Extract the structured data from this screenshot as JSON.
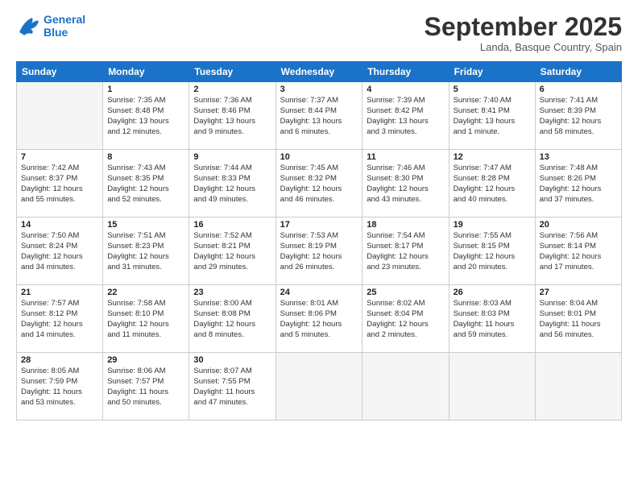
{
  "logo": {
    "line1": "General",
    "line2": "Blue"
  },
  "title": "September 2025",
  "subtitle": "Landa, Basque Country, Spain",
  "days_of_week": [
    "Sunday",
    "Monday",
    "Tuesday",
    "Wednesday",
    "Thursday",
    "Friday",
    "Saturday"
  ],
  "weeks": [
    [
      {
        "day": "",
        "info": ""
      },
      {
        "day": "1",
        "info": "Sunrise: 7:35 AM\nSunset: 8:48 PM\nDaylight: 13 hours\nand 12 minutes."
      },
      {
        "day": "2",
        "info": "Sunrise: 7:36 AM\nSunset: 8:46 PM\nDaylight: 13 hours\nand 9 minutes."
      },
      {
        "day": "3",
        "info": "Sunrise: 7:37 AM\nSunset: 8:44 PM\nDaylight: 13 hours\nand 6 minutes."
      },
      {
        "day": "4",
        "info": "Sunrise: 7:39 AM\nSunset: 8:42 PM\nDaylight: 13 hours\nand 3 minutes."
      },
      {
        "day": "5",
        "info": "Sunrise: 7:40 AM\nSunset: 8:41 PM\nDaylight: 13 hours\nand 1 minute."
      },
      {
        "day": "6",
        "info": "Sunrise: 7:41 AM\nSunset: 8:39 PM\nDaylight: 12 hours\nand 58 minutes."
      }
    ],
    [
      {
        "day": "7",
        "info": "Sunrise: 7:42 AM\nSunset: 8:37 PM\nDaylight: 12 hours\nand 55 minutes."
      },
      {
        "day": "8",
        "info": "Sunrise: 7:43 AM\nSunset: 8:35 PM\nDaylight: 12 hours\nand 52 minutes."
      },
      {
        "day": "9",
        "info": "Sunrise: 7:44 AM\nSunset: 8:33 PM\nDaylight: 12 hours\nand 49 minutes."
      },
      {
        "day": "10",
        "info": "Sunrise: 7:45 AM\nSunset: 8:32 PM\nDaylight: 12 hours\nand 46 minutes."
      },
      {
        "day": "11",
        "info": "Sunrise: 7:46 AM\nSunset: 8:30 PM\nDaylight: 12 hours\nand 43 minutes."
      },
      {
        "day": "12",
        "info": "Sunrise: 7:47 AM\nSunset: 8:28 PM\nDaylight: 12 hours\nand 40 minutes."
      },
      {
        "day": "13",
        "info": "Sunrise: 7:48 AM\nSunset: 8:26 PM\nDaylight: 12 hours\nand 37 minutes."
      }
    ],
    [
      {
        "day": "14",
        "info": "Sunrise: 7:50 AM\nSunset: 8:24 PM\nDaylight: 12 hours\nand 34 minutes."
      },
      {
        "day": "15",
        "info": "Sunrise: 7:51 AM\nSunset: 8:23 PM\nDaylight: 12 hours\nand 31 minutes."
      },
      {
        "day": "16",
        "info": "Sunrise: 7:52 AM\nSunset: 8:21 PM\nDaylight: 12 hours\nand 29 minutes."
      },
      {
        "day": "17",
        "info": "Sunrise: 7:53 AM\nSunset: 8:19 PM\nDaylight: 12 hours\nand 26 minutes."
      },
      {
        "day": "18",
        "info": "Sunrise: 7:54 AM\nSunset: 8:17 PM\nDaylight: 12 hours\nand 23 minutes."
      },
      {
        "day": "19",
        "info": "Sunrise: 7:55 AM\nSunset: 8:15 PM\nDaylight: 12 hours\nand 20 minutes."
      },
      {
        "day": "20",
        "info": "Sunrise: 7:56 AM\nSunset: 8:14 PM\nDaylight: 12 hours\nand 17 minutes."
      }
    ],
    [
      {
        "day": "21",
        "info": "Sunrise: 7:57 AM\nSunset: 8:12 PM\nDaylight: 12 hours\nand 14 minutes."
      },
      {
        "day": "22",
        "info": "Sunrise: 7:58 AM\nSunset: 8:10 PM\nDaylight: 12 hours\nand 11 minutes."
      },
      {
        "day": "23",
        "info": "Sunrise: 8:00 AM\nSunset: 8:08 PM\nDaylight: 12 hours\nand 8 minutes."
      },
      {
        "day": "24",
        "info": "Sunrise: 8:01 AM\nSunset: 8:06 PM\nDaylight: 12 hours\nand 5 minutes."
      },
      {
        "day": "25",
        "info": "Sunrise: 8:02 AM\nSunset: 8:04 PM\nDaylight: 12 hours\nand 2 minutes."
      },
      {
        "day": "26",
        "info": "Sunrise: 8:03 AM\nSunset: 8:03 PM\nDaylight: 11 hours\nand 59 minutes."
      },
      {
        "day": "27",
        "info": "Sunrise: 8:04 AM\nSunset: 8:01 PM\nDaylight: 11 hours\nand 56 minutes."
      }
    ],
    [
      {
        "day": "28",
        "info": "Sunrise: 8:05 AM\nSunset: 7:59 PM\nDaylight: 11 hours\nand 53 minutes."
      },
      {
        "day": "29",
        "info": "Sunrise: 8:06 AM\nSunset: 7:57 PM\nDaylight: 11 hours\nand 50 minutes."
      },
      {
        "day": "30",
        "info": "Sunrise: 8:07 AM\nSunset: 7:55 PM\nDaylight: 11 hours\nand 47 minutes."
      },
      {
        "day": "",
        "info": ""
      },
      {
        "day": "",
        "info": ""
      },
      {
        "day": "",
        "info": ""
      },
      {
        "day": "",
        "info": ""
      }
    ]
  ]
}
